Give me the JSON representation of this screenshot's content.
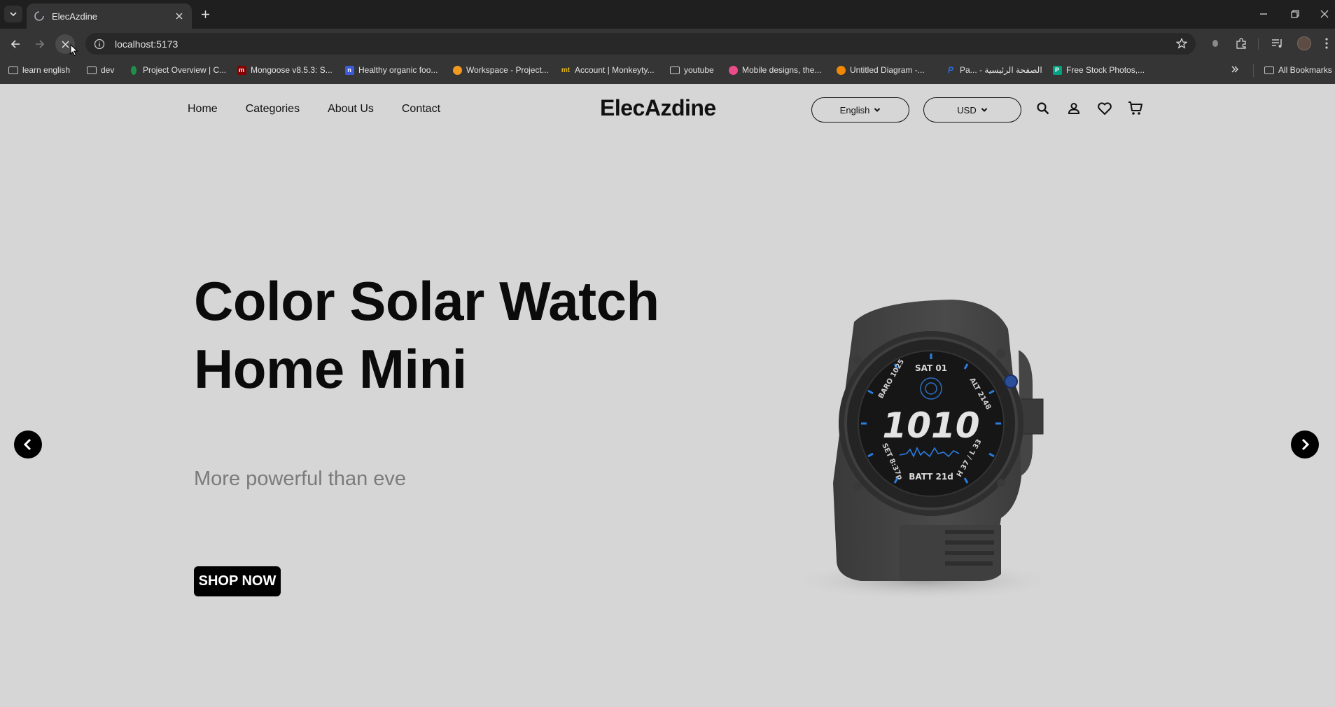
{
  "browser": {
    "tab": {
      "title": "ElecAzdine"
    },
    "address_bar": {
      "url": "localhost:5173"
    },
    "bookmarks": [
      {
        "label": "learn english",
        "icon": "folder-icon"
      },
      {
        "label": "dev",
        "icon": "folder-icon"
      },
      {
        "label": "Project Overview | C...",
        "icon": "mongodb-leaf-icon"
      },
      {
        "label": "Mongoose v8.5.3: S...",
        "icon": "mongoose-icon"
      },
      {
        "label": "Healthy organic foo...",
        "icon": "n-icon"
      },
      {
        "label": "Workspace - Project...",
        "icon": "orange-circle-icon"
      },
      {
        "label": "Account | Monkeyty...",
        "icon": "mt-icon"
      },
      {
        "label": "youtube",
        "icon": "folder-icon"
      },
      {
        "label": "Mobile designs, the...",
        "icon": "dribbble-icon"
      },
      {
        "label": "Untitled Diagram -...",
        "icon": "drawio-icon"
      },
      {
        "label": "Pa... - الصفحة الرئيسية",
        "icon": "paypal-icon"
      },
      {
        "label": "Free Stock Photos,...",
        "icon": "pexels-icon"
      }
    ],
    "all_bookmarks_label": "All Bookmarks"
  },
  "site": {
    "brand": "ElecAzdine",
    "nav": [
      "Home",
      "Categories",
      "About Us",
      "Contact"
    ],
    "language_select": "English",
    "currency_select": "USD",
    "icons": [
      "search-icon",
      "user-icon",
      "heart-icon",
      "cart-icon"
    ]
  },
  "hero": {
    "title_line1": "Color Solar Watch",
    "title_line2": "Home Mini",
    "subtitle": "More powerful than eve",
    "cta_label": "SHOP NOW"
  },
  "watch_face": {
    "time": "1010",
    "top": "SAT 01",
    "bottom": "BATT 21d",
    "left_top": "BARO 1025",
    "left_bottom": "SET 8:37p",
    "right_top": "ALT 2148",
    "right_bottom": "H 37 / L 33"
  },
  "colors": {
    "page_bg": "#d6d6d6",
    "chrome_bg": "#1f1f1f",
    "toolbar_bg": "#353535",
    "accent": "#000000"
  }
}
